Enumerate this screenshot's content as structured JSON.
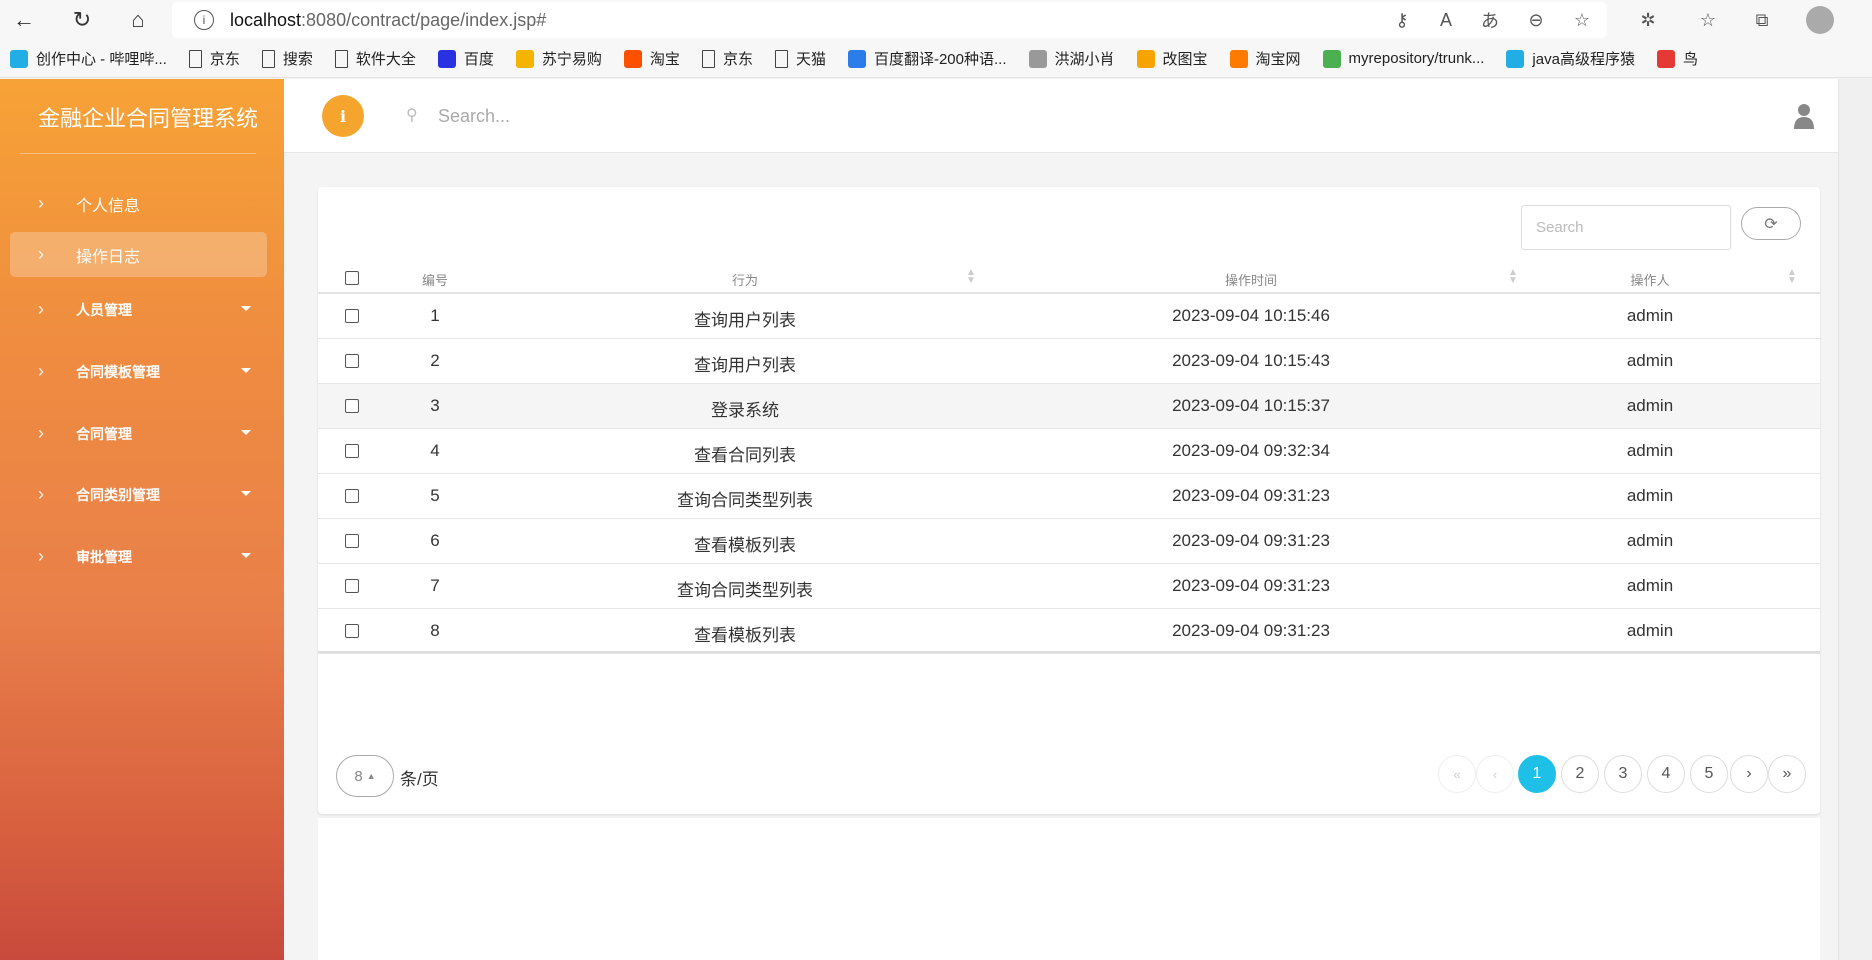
{
  "browser": {
    "url_host": "localhost",
    "url_path": ":8080/contract/page/index.jsp#",
    "bookmarks": [
      {
        "label": "创作中心 - 哔哩哔...",
        "icon": "bilibili-icon",
        "color": "#23ade5"
      },
      {
        "label": "京东",
        "icon": "page-icon",
        "color": ""
      },
      {
        "label": "搜索",
        "icon": "page-icon",
        "color": ""
      },
      {
        "label": "软件大全",
        "icon": "page-icon",
        "color": ""
      },
      {
        "label": "百度",
        "icon": "baidu-icon",
        "color": "#2932e1"
      },
      {
        "label": "苏宁易购",
        "icon": "suning-icon",
        "color": "#f5b400"
      },
      {
        "label": "淘宝",
        "icon": "taobao-icon",
        "color": "#ff5000"
      },
      {
        "label": "京东",
        "icon": "page-icon",
        "color": ""
      },
      {
        "label": "天猫",
        "icon": "page-icon",
        "color": ""
      },
      {
        "label": "百度翻译-200种语...",
        "icon": "translate-icon",
        "color": "#2b7de9"
      },
      {
        "label": "洪湖小肖",
        "icon": "bird-icon",
        "color": "#999999"
      },
      {
        "label": "改图宝",
        "icon": "gaitubao-icon",
        "color": "#f7a400"
      },
      {
        "label": "淘宝网",
        "icon": "taobao-icon",
        "color": "#ff7a00"
      },
      {
        "label": "myrepository/trunk...",
        "icon": "chrome-icon",
        "color": "#4caf50"
      },
      {
        "label": "java高级程序猿",
        "icon": "bilibili-icon",
        "color": "#23ade5"
      },
      {
        "label": "鸟",
        "icon": "bird-icon",
        "color": "#e53935"
      }
    ]
  },
  "sidebar": {
    "title": "金融企业合同管理系统",
    "items": [
      {
        "label": "个人信息",
        "active": false,
        "submenu": false
      },
      {
        "label": "操作日志",
        "active": true,
        "submenu": false
      },
      {
        "label": "人员管理",
        "active": false,
        "submenu": true
      },
      {
        "label": "合同模板管理",
        "active": false,
        "submenu": true
      },
      {
        "label": "合同管理",
        "active": false,
        "submenu": true
      },
      {
        "label": "合同类别管理",
        "active": false,
        "submenu": true
      },
      {
        "label": "审批管理",
        "active": false,
        "submenu": true
      }
    ]
  },
  "topbar": {
    "search_placeholder": "Search..."
  },
  "table": {
    "search_placeholder": "Search",
    "columns": [
      "编号",
      "行为",
      "操作时间",
      "操作人"
    ],
    "rows": [
      {
        "id": "1",
        "action": "查询用户列表",
        "time": "2023-09-04 10:15:46",
        "user": "admin"
      },
      {
        "id": "2",
        "action": "查询用户列表",
        "time": "2023-09-04 10:15:43",
        "user": "admin"
      },
      {
        "id": "3",
        "action": "登录系统",
        "time": "2023-09-04 10:15:37",
        "user": "admin"
      },
      {
        "id": "4",
        "action": "查看合同列表",
        "time": "2023-09-04 09:32:34",
        "user": "admin"
      },
      {
        "id": "5",
        "action": "查询合同类型列表",
        "time": "2023-09-04 09:31:23",
        "user": "admin"
      },
      {
        "id": "6",
        "action": "查看模板列表",
        "time": "2023-09-04 09:31:23",
        "user": "admin"
      },
      {
        "id": "7",
        "action": "查询合同类型列表",
        "time": "2023-09-04 09:31:23",
        "user": "admin"
      },
      {
        "id": "8",
        "action": "查看模板列表",
        "time": "2023-09-04 09:31:23",
        "user": "admin"
      }
    ]
  },
  "pagination": {
    "page_size": "8",
    "per_page_label": "条/页",
    "first": "«",
    "prev": "‹",
    "next": "›",
    "last": "»",
    "pages": [
      "1",
      "2",
      "3",
      "4",
      "5"
    ],
    "current": "1",
    "accent": "#1fc0e8"
  }
}
